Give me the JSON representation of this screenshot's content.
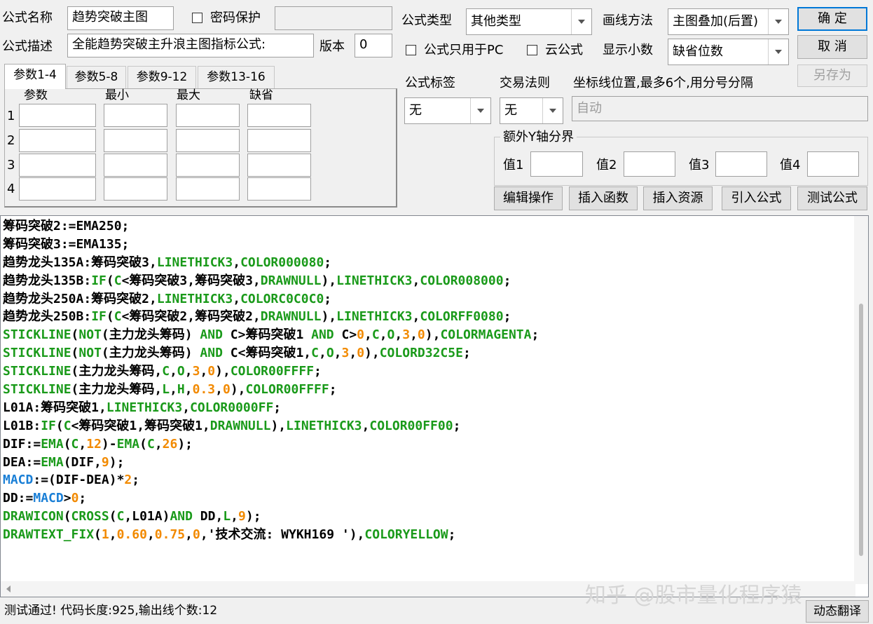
{
  "formula": {
    "name_label": "公式名称",
    "name_value": "趋势突破主图",
    "password_label": "密码保护",
    "desc_label": "公式描述",
    "desc_value": "全能趋势突破主升浪主图指标公式:",
    "version_label": "版本",
    "version_value": "0"
  },
  "param_tabs": [
    "参数1-4",
    "参数5-8",
    "参数9-12",
    "参数13-16"
  ],
  "param_headers": [
    "参数",
    "最小",
    "最大",
    "缺省"
  ],
  "param_rows": [
    "1",
    "2",
    "3",
    "4"
  ],
  "options": {
    "type_label": "公式类型",
    "type_value": "其他类型",
    "draw_label": "画线方法",
    "draw_value": "主图叠加(后置)",
    "pc_only_label": "公式只用于PC",
    "cloud_label": "云公式",
    "decimal_label": "显示小数",
    "decimal_value": "缺省位数",
    "tag_label": "公式标签",
    "tag_value": "无",
    "rule_label": "交易法则",
    "rule_value": "无",
    "axis_label": "坐标线位置,最多6个,用分号分隔",
    "axis_placeholder": "自动",
    "yaxis_group": "额外Y轴分界",
    "yaxis_values": [
      "值1",
      "值2",
      "值3",
      "值4"
    ]
  },
  "buttons": {
    "ok": "确  定",
    "cancel": "取  消",
    "save_as": "另存为",
    "edit_ops": "编辑操作",
    "insert_func": "插入函数",
    "insert_res": "插入资源",
    "import_formula": "引入公式",
    "test_formula": "测试公式",
    "dynamic_translate": "动态翻译"
  },
  "code_lines": [
    [
      [
        "筹码突破2:=EMA250;",
        "d"
      ]
    ],
    [
      [
        "筹码突破3:=EMA135;",
        "d"
      ]
    ],
    [
      [
        "趋势龙头135A:筹码突破3,",
        "d"
      ],
      [
        "LINETHICK3",
        "k"
      ],
      [
        ",",
        "d"
      ],
      [
        "COLOR000080",
        "k"
      ],
      [
        ";",
        "d"
      ]
    ],
    [
      [
        "趋势龙头135B:",
        "d"
      ],
      [
        "IF",
        "k"
      ],
      [
        "(",
        "d"
      ],
      [
        "C",
        "k"
      ],
      [
        "<筹码突破3,筹码突破3,",
        "d"
      ],
      [
        "DRAWNULL",
        "k"
      ],
      [
        "),",
        "d"
      ],
      [
        "LINETHICK3",
        "k"
      ],
      [
        ",",
        "d"
      ],
      [
        "COLOR008000",
        "k"
      ],
      [
        ";",
        "d"
      ]
    ],
    [
      [
        "趋势龙头250A:筹码突破2,",
        "d"
      ],
      [
        "LINETHICK3",
        "k"
      ],
      [
        ",",
        "d"
      ],
      [
        "COLORC0C0C0",
        "k"
      ],
      [
        ";",
        "d"
      ]
    ],
    [
      [
        "趋势龙头250B:",
        "d"
      ],
      [
        "IF",
        "k"
      ],
      [
        "(",
        "d"
      ],
      [
        "C",
        "k"
      ],
      [
        "<筹码突破2,筹码突破2,",
        "d"
      ],
      [
        "DRAWNULL",
        "k"
      ],
      [
        "),",
        "d"
      ],
      [
        "LINETHICK3",
        "k"
      ],
      [
        ",",
        "d"
      ],
      [
        "COLORFF0080",
        "k"
      ],
      [
        ";",
        "d"
      ]
    ],
    [
      [
        "STICKLINE",
        "k"
      ],
      [
        "(",
        "d"
      ],
      [
        "NOT",
        "k"
      ],
      [
        "(主力龙头筹码) ",
        "d"
      ],
      [
        "AND",
        "k"
      ],
      [
        " C>筹码突破1 ",
        "d"
      ],
      [
        "AND",
        "k"
      ],
      [
        " C>",
        "d"
      ],
      [
        "0",
        "n"
      ],
      [
        ",",
        "d"
      ],
      [
        "C",
        "k"
      ],
      [
        ",",
        "d"
      ],
      [
        "O",
        "k"
      ],
      [
        ",",
        "d"
      ],
      [
        "3",
        "n"
      ],
      [
        ",",
        "d"
      ],
      [
        "0",
        "n"
      ],
      [
        "),",
        "d"
      ],
      [
        "COLORMAGENTA",
        "k"
      ],
      [
        ";",
        "d"
      ]
    ],
    [
      [
        "STICKLINE",
        "k"
      ],
      [
        "(",
        "d"
      ],
      [
        "NOT",
        "k"
      ],
      [
        "(主力龙头筹码) ",
        "d"
      ],
      [
        "AND",
        "k"
      ],
      [
        " C<筹码突破1,",
        "d"
      ],
      [
        "C",
        "k"
      ],
      [
        ",",
        "d"
      ],
      [
        "O",
        "k"
      ],
      [
        ",",
        "d"
      ],
      [
        "3",
        "n"
      ],
      [
        ",",
        "d"
      ],
      [
        "0",
        "n"
      ],
      [
        "),",
        "d"
      ],
      [
        "COLORD32C5E",
        "k"
      ],
      [
        ";",
        "d"
      ]
    ],
    [
      [
        "STICKLINE",
        "k"
      ],
      [
        "(主力龙头筹码,",
        "d"
      ],
      [
        "C",
        "k"
      ],
      [
        ",",
        "d"
      ],
      [
        "O",
        "k"
      ],
      [
        ",",
        "d"
      ],
      [
        "3",
        "n"
      ],
      [
        ",",
        "d"
      ],
      [
        "0",
        "n"
      ],
      [
        "),",
        "d"
      ],
      [
        "COLOR00FFFF",
        "k"
      ],
      [
        ";",
        "d"
      ]
    ],
    [
      [
        "STICKLINE",
        "k"
      ],
      [
        "(主力龙头筹码,",
        "d"
      ],
      [
        "L",
        "k"
      ],
      [
        ",",
        "d"
      ],
      [
        "H",
        "k"
      ],
      [
        ",",
        "d"
      ],
      [
        "0.3",
        "n"
      ],
      [
        ",",
        "d"
      ],
      [
        "0",
        "n"
      ],
      [
        "),",
        "d"
      ],
      [
        "COLOR00FFFF",
        "k"
      ],
      [
        ";",
        "d"
      ]
    ],
    [
      [
        "L01A:筹码突破1,",
        "d"
      ],
      [
        "LINETHICK3",
        "k"
      ],
      [
        ",",
        "d"
      ],
      [
        "COLOR0000FF",
        "k"
      ],
      [
        ";",
        "d"
      ]
    ],
    [
      [
        "L01B:",
        "d"
      ],
      [
        "IF",
        "k"
      ],
      [
        "(",
        "d"
      ],
      [
        "C",
        "k"
      ],
      [
        "<筹码突破1,筹码突破1,",
        "d"
      ],
      [
        "DRAWNULL",
        "k"
      ],
      [
        "),",
        "d"
      ],
      [
        "LINETHICK3",
        "k"
      ],
      [
        ",",
        "d"
      ],
      [
        "COLOR00FF00",
        "k"
      ],
      [
        ";",
        "d"
      ]
    ],
    [
      [
        "DIF:=",
        "d"
      ],
      [
        "EMA",
        "k"
      ],
      [
        "(",
        "d"
      ],
      [
        "C",
        "k"
      ],
      [
        ",",
        "d"
      ],
      [
        "12",
        "n"
      ],
      [
        ")-",
        "d"
      ],
      [
        "EMA",
        "k"
      ],
      [
        "(",
        "d"
      ],
      [
        "C",
        "k"
      ],
      [
        ",",
        "d"
      ],
      [
        "26",
        "n"
      ],
      [
        ");",
        "d"
      ]
    ],
    [
      [
        "DEA:=",
        "d"
      ],
      [
        "EMA",
        "k"
      ],
      [
        "(DIF,",
        "d"
      ],
      [
        "9",
        "n"
      ],
      [
        ");",
        "d"
      ]
    ],
    [
      [
        "MACD",
        "b"
      ],
      [
        ":=(DIF-DEA)*",
        "d"
      ],
      [
        "2",
        "n"
      ],
      [
        ";",
        "d"
      ]
    ],
    [
      [
        "DD:=",
        "d"
      ],
      [
        "MACD",
        "b"
      ],
      [
        ">",
        "d"
      ],
      [
        "0",
        "n"
      ],
      [
        ";",
        "d"
      ]
    ],
    [
      [
        "DRAWICON",
        "k"
      ],
      [
        "(",
        "d"
      ],
      [
        "CROSS",
        "k"
      ],
      [
        "(",
        "d"
      ],
      [
        "C",
        "k"
      ],
      [
        ",L01A)",
        "d"
      ],
      [
        "AND",
        "k"
      ],
      [
        " DD,",
        "d"
      ],
      [
        "L",
        "k"
      ],
      [
        ",",
        "d"
      ],
      [
        "9",
        "n"
      ],
      [
        ");",
        "d"
      ]
    ],
    [
      [
        "DRAWTEXT_FIX",
        "k"
      ],
      [
        "(",
        "d"
      ],
      [
        "1",
        "n"
      ],
      [
        ",",
        "d"
      ],
      [
        "0.60",
        "n"
      ],
      [
        ",",
        "d"
      ],
      [
        "0.75",
        "n"
      ],
      [
        ",",
        "d"
      ],
      [
        "0",
        "n"
      ],
      [
        ",'技术交流: WYKH169 '),",
        "d"
      ],
      [
        "COLORYELLOW",
        "k"
      ],
      [
        ";",
        "d"
      ]
    ]
  ],
  "watermark": "知乎 @股市量化程序猿",
  "status_text": "测试通过! 代码长度:925,输出线个数:12"
}
